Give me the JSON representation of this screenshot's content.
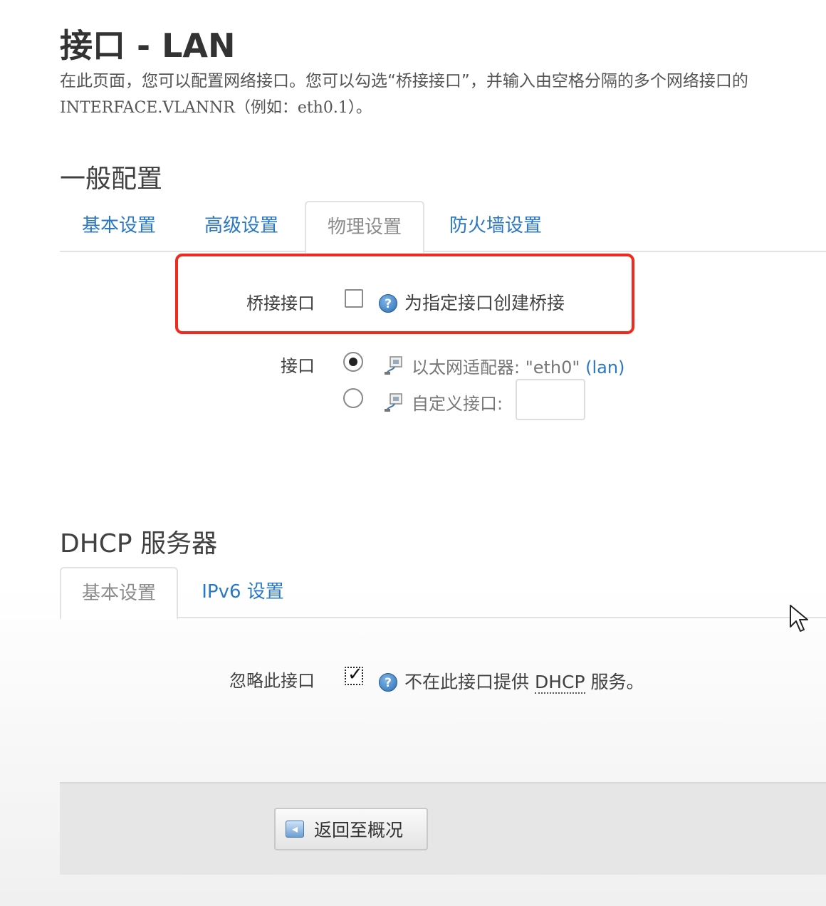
{
  "page": {
    "title": "接口 - LAN",
    "description_line1": "在此页面，您可以配置网络接口。您可以勾选“桥接接口”，并输入由空格分隔的多个网络接口的",
    "description_line2": "INTERFACE.VLANNR（例如：eth0.1）。"
  },
  "general": {
    "section_title": "一般配置",
    "tabs": [
      {
        "label": "基本设置",
        "active": false
      },
      {
        "label": "高级设置",
        "active": false
      },
      {
        "label": "物理设置",
        "active": true
      },
      {
        "label": "防火墙设置",
        "active": false
      }
    ],
    "bridge": {
      "label": "桥接接口",
      "checked": false,
      "help_icon": "help-icon",
      "hint": "为指定接口创建桥接"
    },
    "interface": {
      "label": "接口",
      "options": [
        {
          "icon": "ethernet-adapter-icon",
          "text": "以太网适配器: \"eth0\"",
          "network": "(lan)",
          "selected": true
        },
        {
          "icon": "ethernet-adapter-icon",
          "text": "自定义接口:",
          "selected": false,
          "input_value": ""
        }
      ]
    }
  },
  "dhcp": {
    "section_title": "DHCP 服务器",
    "tabs": [
      {
        "label": "基本设置",
        "active": true
      },
      {
        "label": "IPv6 设置",
        "active": false
      }
    ],
    "ignore": {
      "label": "忽略此接口",
      "checked": true,
      "hint_prefix": "不在此接口提供",
      "hint_abbr": "DHCP",
      "hint_suffix": "服务。"
    }
  },
  "footer": {
    "back_button_label": "返回至概况",
    "back_icon": "back-arrow-icon"
  },
  "colors": {
    "accent_link": "#2a78c4",
    "highlight_border": "#ee2b1f"
  }
}
